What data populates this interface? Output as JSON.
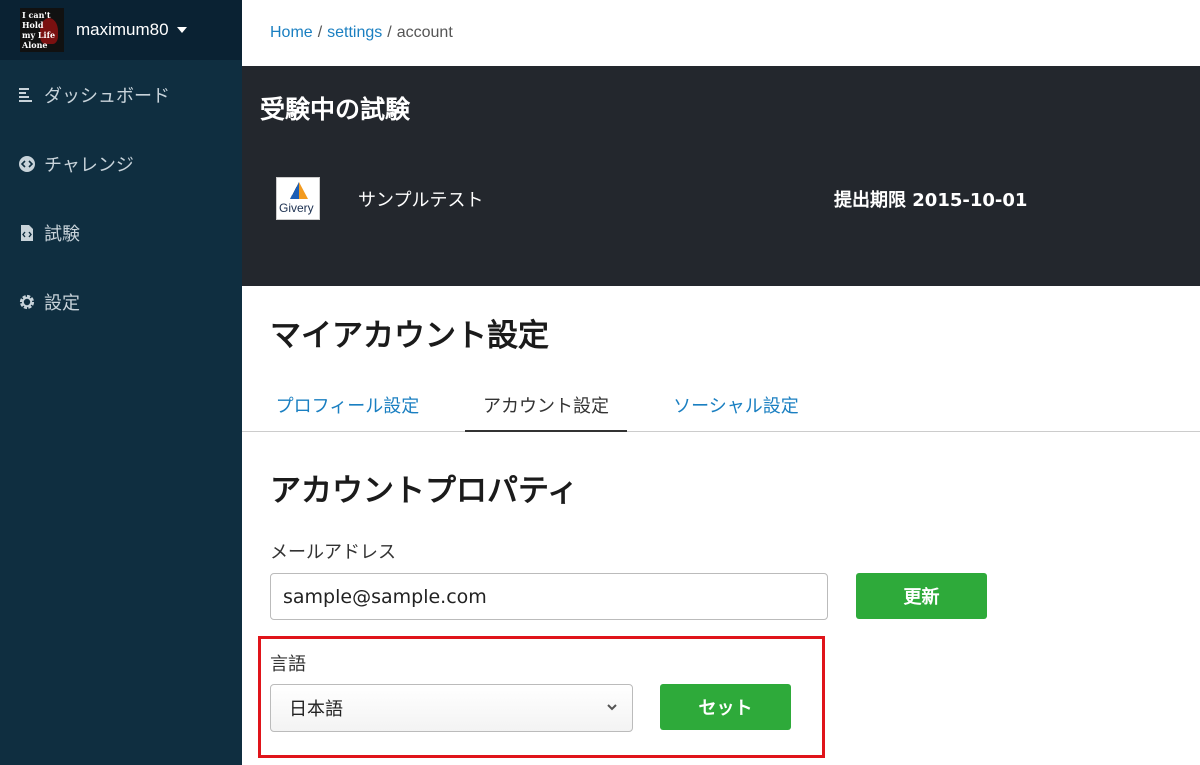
{
  "sidebar": {
    "username": "maximum80",
    "avatar_text": [
      "I can't Hold",
      "my Life",
      "Alone"
    ],
    "items": [
      {
        "label": "ダッシュボード",
        "icon": "dashboard-icon"
      },
      {
        "label": "チャレンジ",
        "icon": "code-circle-icon"
      },
      {
        "label": "試験",
        "icon": "code-file-icon"
      },
      {
        "label": "設定",
        "icon": "gear-icon"
      }
    ]
  },
  "breadcrumb": {
    "home": "Home",
    "settings": "settings",
    "current": "account",
    "separator": "/"
  },
  "exam": {
    "heading": "受験中の試験",
    "logo_text": "Givery",
    "name": "サンプルテスト",
    "deadline": "提出期限 2015-10-01"
  },
  "page": {
    "title": "マイアカウント設定",
    "tabs": [
      {
        "label": "プロフィール設定",
        "active": false
      },
      {
        "label": "アカウント設定",
        "active": true
      },
      {
        "label": "ソーシャル設定",
        "active": false
      }
    ]
  },
  "account": {
    "section_title": "アカウントプロパティ",
    "email_label": "メールアドレス",
    "email_value": "sample@sample.com",
    "update_button": "更新",
    "language_label": "言語",
    "language_selected": "日本語",
    "set_button": "セット"
  },
  "colors": {
    "sidebar_bg": "#0f2e40",
    "exam_panel_bg": "#23272d",
    "link": "#1a7fc1",
    "button_green": "#2eaa3a",
    "highlight_red": "#e0141a"
  }
}
